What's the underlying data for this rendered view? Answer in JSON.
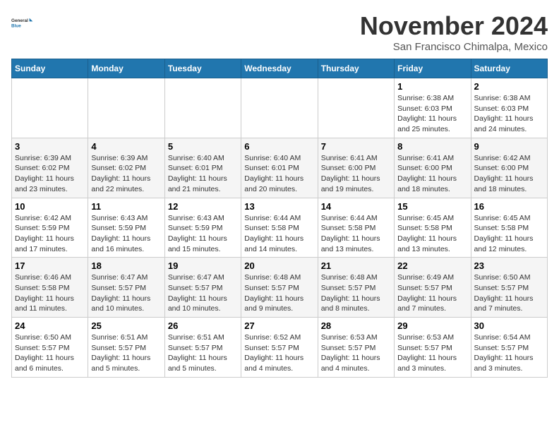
{
  "header": {
    "logo_line1": "General",
    "logo_line2": "Blue",
    "month": "November 2024",
    "location": "San Francisco Chimalpa, Mexico"
  },
  "weekdays": [
    "Sunday",
    "Monday",
    "Tuesday",
    "Wednesday",
    "Thursday",
    "Friday",
    "Saturday"
  ],
  "weeks": [
    [
      {
        "day": "",
        "info": ""
      },
      {
        "day": "",
        "info": ""
      },
      {
        "day": "",
        "info": ""
      },
      {
        "day": "",
        "info": ""
      },
      {
        "day": "",
        "info": ""
      },
      {
        "day": "1",
        "info": "Sunrise: 6:38 AM\nSunset: 6:03 PM\nDaylight: 11 hours and 25 minutes."
      },
      {
        "day": "2",
        "info": "Sunrise: 6:38 AM\nSunset: 6:03 PM\nDaylight: 11 hours and 24 minutes."
      }
    ],
    [
      {
        "day": "3",
        "info": "Sunrise: 6:39 AM\nSunset: 6:02 PM\nDaylight: 11 hours and 23 minutes."
      },
      {
        "day": "4",
        "info": "Sunrise: 6:39 AM\nSunset: 6:02 PM\nDaylight: 11 hours and 22 minutes."
      },
      {
        "day": "5",
        "info": "Sunrise: 6:40 AM\nSunset: 6:01 PM\nDaylight: 11 hours and 21 minutes."
      },
      {
        "day": "6",
        "info": "Sunrise: 6:40 AM\nSunset: 6:01 PM\nDaylight: 11 hours and 20 minutes."
      },
      {
        "day": "7",
        "info": "Sunrise: 6:41 AM\nSunset: 6:00 PM\nDaylight: 11 hours and 19 minutes."
      },
      {
        "day": "8",
        "info": "Sunrise: 6:41 AM\nSunset: 6:00 PM\nDaylight: 11 hours and 18 minutes."
      },
      {
        "day": "9",
        "info": "Sunrise: 6:42 AM\nSunset: 6:00 PM\nDaylight: 11 hours and 18 minutes."
      }
    ],
    [
      {
        "day": "10",
        "info": "Sunrise: 6:42 AM\nSunset: 5:59 PM\nDaylight: 11 hours and 17 minutes."
      },
      {
        "day": "11",
        "info": "Sunrise: 6:43 AM\nSunset: 5:59 PM\nDaylight: 11 hours and 16 minutes."
      },
      {
        "day": "12",
        "info": "Sunrise: 6:43 AM\nSunset: 5:59 PM\nDaylight: 11 hours and 15 minutes."
      },
      {
        "day": "13",
        "info": "Sunrise: 6:44 AM\nSunset: 5:58 PM\nDaylight: 11 hours and 14 minutes."
      },
      {
        "day": "14",
        "info": "Sunrise: 6:44 AM\nSunset: 5:58 PM\nDaylight: 11 hours and 13 minutes."
      },
      {
        "day": "15",
        "info": "Sunrise: 6:45 AM\nSunset: 5:58 PM\nDaylight: 11 hours and 13 minutes."
      },
      {
        "day": "16",
        "info": "Sunrise: 6:45 AM\nSunset: 5:58 PM\nDaylight: 11 hours and 12 minutes."
      }
    ],
    [
      {
        "day": "17",
        "info": "Sunrise: 6:46 AM\nSunset: 5:58 PM\nDaylight: 11 hours and 11 minutes."
      },
      {
        "day": "18",
        "info": "Sunrise: 6:47 AM\nSunset: 5:57 PM\nDaylight: 11 hours and 10 minutes."
      },
      {
        "day": "19",
        "info": "Sunrise: 6:47 AM\nSunset: 5:57 PM\nDaylight: 11 hours and 10 minutes."
      },
      {
        "day": "20",
        "info": "Sunrise: 6:48 AM\nSunset: 5:57 PM\nDaylight: 11 hours and 9 minutes."
      },
      {
        "day": "21",
        "info": "Sunrise: 6:48 AM\nSunset: 5:57 PM\nDaylight: 11 hours and 8 minutes."
      },
      {
        "day": "22",
        "info": "Sunrise: 6:49 AM\nSunset: 5:57 PM\nDaylight: 11 hours and 7 minutes."
      },
      {
        "day": "23",
        "info": "Sunrise: 6:50 AM\nSunset: 5:57 PM\nDaylight: 11 hours and 7 minutes."
      }
    ],
    [
      {
        "day": "24",
        "info": "Sunrise: 6:50 AM\nSunset: 5:57 PM\nDaylight: 11 hours and 6 minutes."
      },
      {
        "day": "25",
        "info": "Sunrise: 6:51 AM\nSunset: 5:57 PM\nDaylight: 11 hours and 5 minutes."
      },
      {
        "day": "26",
        "info": "Sunrise: 6:51 AM\nSunset: 5:57 PM\nDaylight: 11 hours and 5 minutes."
      },
      {
        "day": "27",
        "info": "Sunrise: 6:52 AM\nSunset: 5:57 PM\nDaylight: 11 hours and 4 minutes."
      },
      {
        "day": "28",
        "info": "Sunrise: 6:53 AM\nSunset: 5:57 PM\nDaylight: 11 hours and 4 minutes."
      },
      {
        "day": "29",
        "info": "Sunrise: 6:53 AM\nSunset: 5:57 PM\nDaylight: 11 hours and 3 minutes."
      },
      {
        "day": "30",
        "info": "Sunrise: 6:54 AM\nSunset: 5:57 PM\nDaylight: 11 hours and 3 minutes."
      }
    ]
  ]
}
